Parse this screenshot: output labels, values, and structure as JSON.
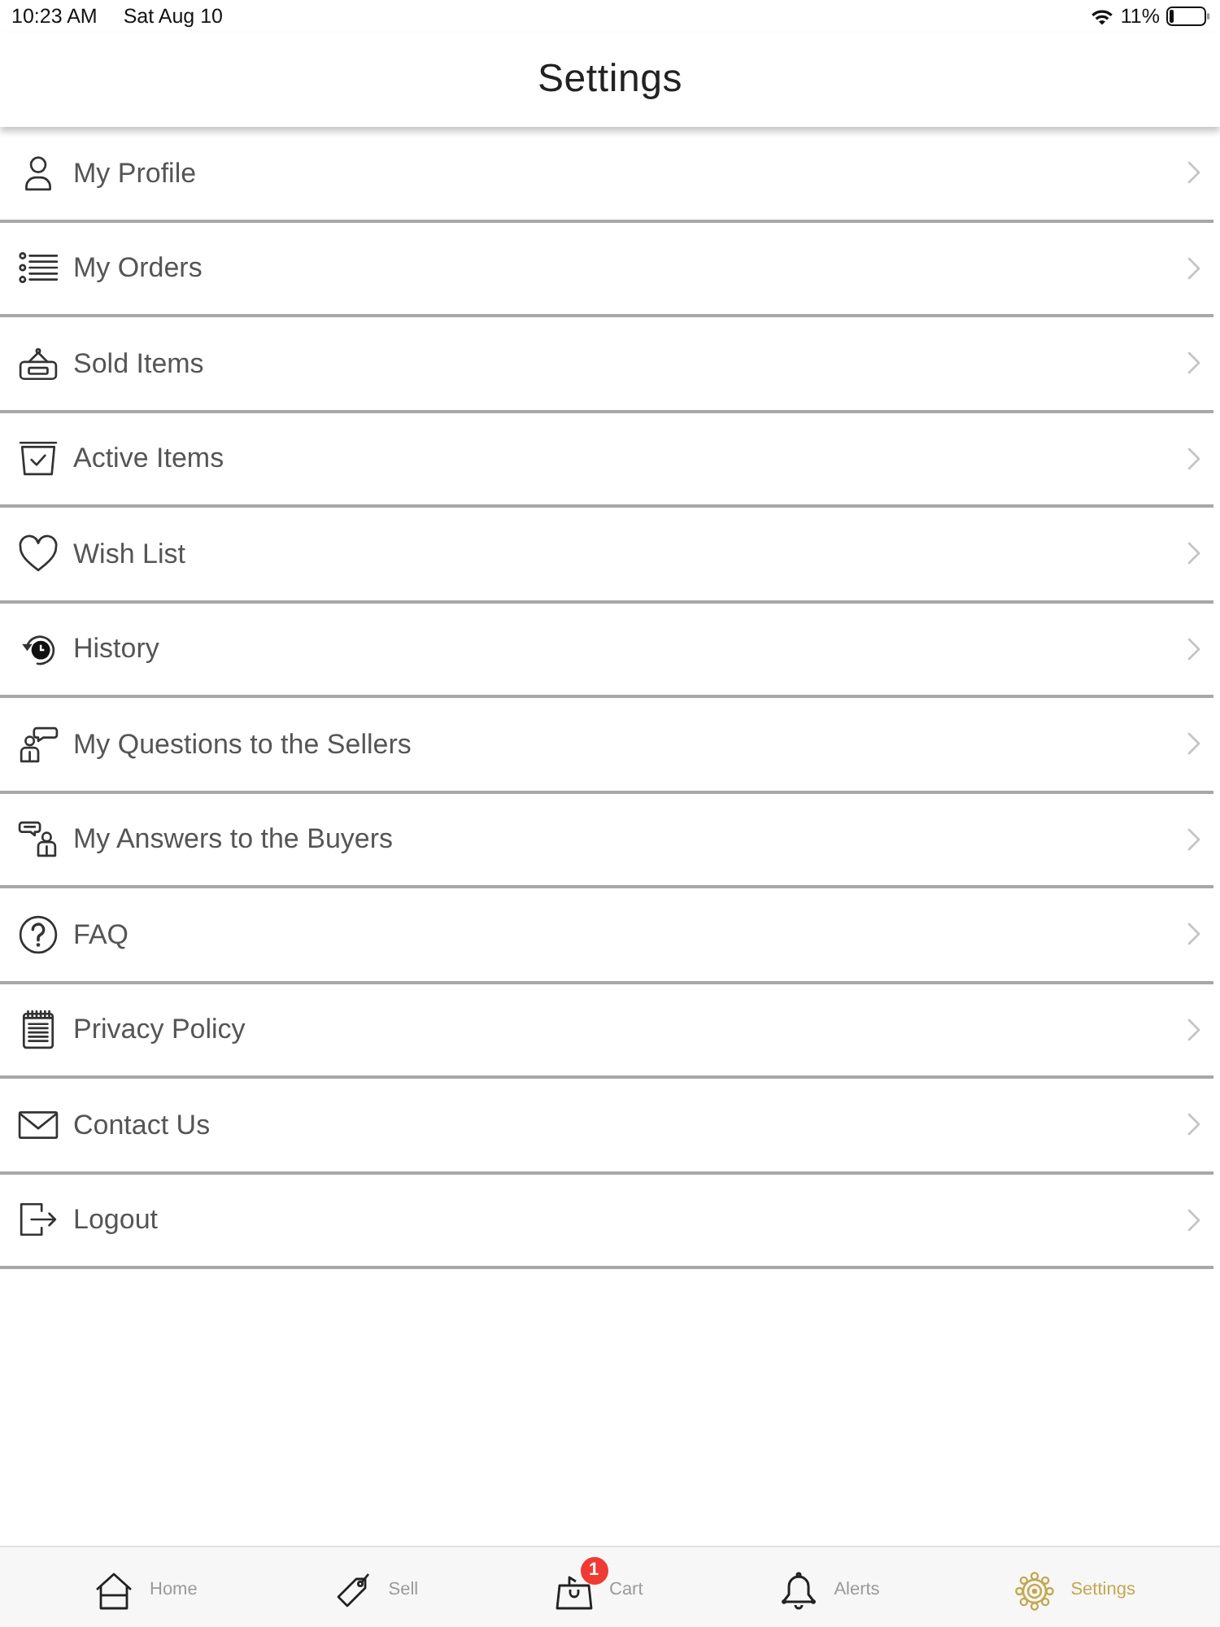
{
  "status_bar": {
    "time": "10:23 AM",
    "date": "Sat Aug 10",
    "battery": "11%"
  },
  "header": {
    "title": "Settings"
  },
  "menu": [
    {
      "label": "My Profile"
    },
    {
      "label": "My Orders"
    },
    {
      "label": "Sold Items"
    },
    {
      "label": "Active Items"
    },
    {
      "label": "Wish List"
    },
    {
      "label": "History"
    },
    {
      "label": "My Questions to the Sellers"
    },
    {
      "label": "My Answers to the Buyers"
    },
    {
      "label": "FAQ"
    },
    {
      "label": "Privacy Policy"
    },
    {
      "label": "Contact Us"
    },
    {
      "label": "Logout"
    }
  ],
  "tab_bar": {
    "tabs": [
      {
        "label": "Home",
        "selected": false
      },
      {
        "label": "Sell",
        "selected": false
      },
      {
        "label": "Cart",
        "selected": false,
        "badge": "1"
      },
      {
        "label": "Alerts",
        "selected": false
      },
      {
        "label": "Settings",
        "selected": true
      }
    ]
  }
}
